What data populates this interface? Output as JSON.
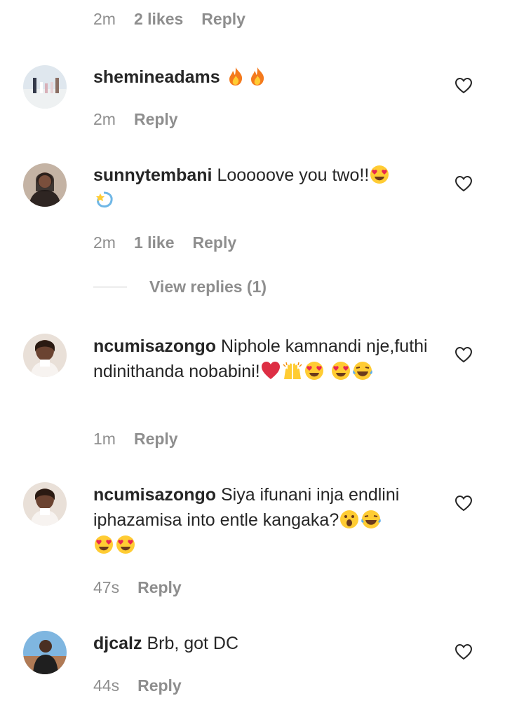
{
  "top": {
    "time": "2m",
    "likes": "2 likes",
    "reply": "Reply"
  },
  "comments": [
    {
      "user": "shemineadams",
      "text": "",
      "emojis": [
        "fire-emoji",
        "fire-emoji"
      ],
      "time": "2m",
      "likes": "",
      "reply": "Reply"
    },
    {
      "user": "sunnytembani",
      "text": "Looooove you two!!",
      "emojis": [
        "heart-eyes-emoji",
        "dizzy-emoji"
      ],
      "time": "2m",
      "likes": "1 like",
      "reply": "Reply"
    },
    {
      "user": "ncumisazongo",
      "text": "Niphole kamnandi nje,futhi ndinithanda nobabini!",
      "emojis": [
        "red-heart-emoji",
        "raising-hands-emoji",
        "heart-eyes-emoji",
        "heart-eyes-emoji",
        "tears-of-joy-emoji"
      ],
      "time": "1m",
      "likes": "",
      "reply": "Reply"
    },
    {
      "user": "ncumisazongo",
      "text": "Siya ifunani inja endlini iphazamisa into entle kangaka?",
      "emojis": [
        "astonished-emoji",
        "tears-of-joy-emoji",
        "heart-eyes-emoji",
        "heart-eyes-emoji"
      ],
      "time": "47s",
      "likes": "",
      "reply": "Reply"
    },
    {
      "user": "djcalz",
      "text": "Brb, got DC",
      "emojis": [],
      "time": "44s",
      "likes": "",
      "reply": "Reply"
    }
  ],
  "view_replies": "View replies (1)",
  "colors": {
    "text": "#262626",
    "meta": "#8e8e8e",
    "divider": "#c7c7c7"
  }
}
